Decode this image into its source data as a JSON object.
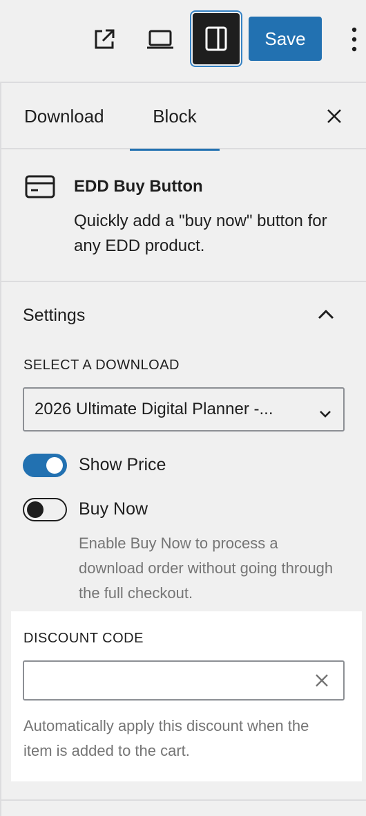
{
  "toolbar": {
    "save_label": "Save",
    "accent_color": "#2271b1"
  },
  "tabs": {
    "download": "Download",
    "block": "Block"
  },
  "block_card": {
    "title": "EDD Buy Button",
    "description": "Quickly add a \"buy now\" button for any EDD product."
  },
  "settings": {
    "title": "Settings",
    "select_label": "SELECT A DOWNLOAD",
    "selected_download": "2026 Ultimate Digital Planner -...",
    "show_price_label": "Show Price",
    "show_price_on": true,
    "buy_now_label": "Buy Now",
    "buy_now_on": false,
    "buy_now_help": "Enable Buy Now to process a download order without going through the full checkout.",
    "discount_label": "DISCOUNT CODE",
    "discount_value": "",
    "discount_help": "Automatically apply this discount when the item is added to the cart."
  }
}
